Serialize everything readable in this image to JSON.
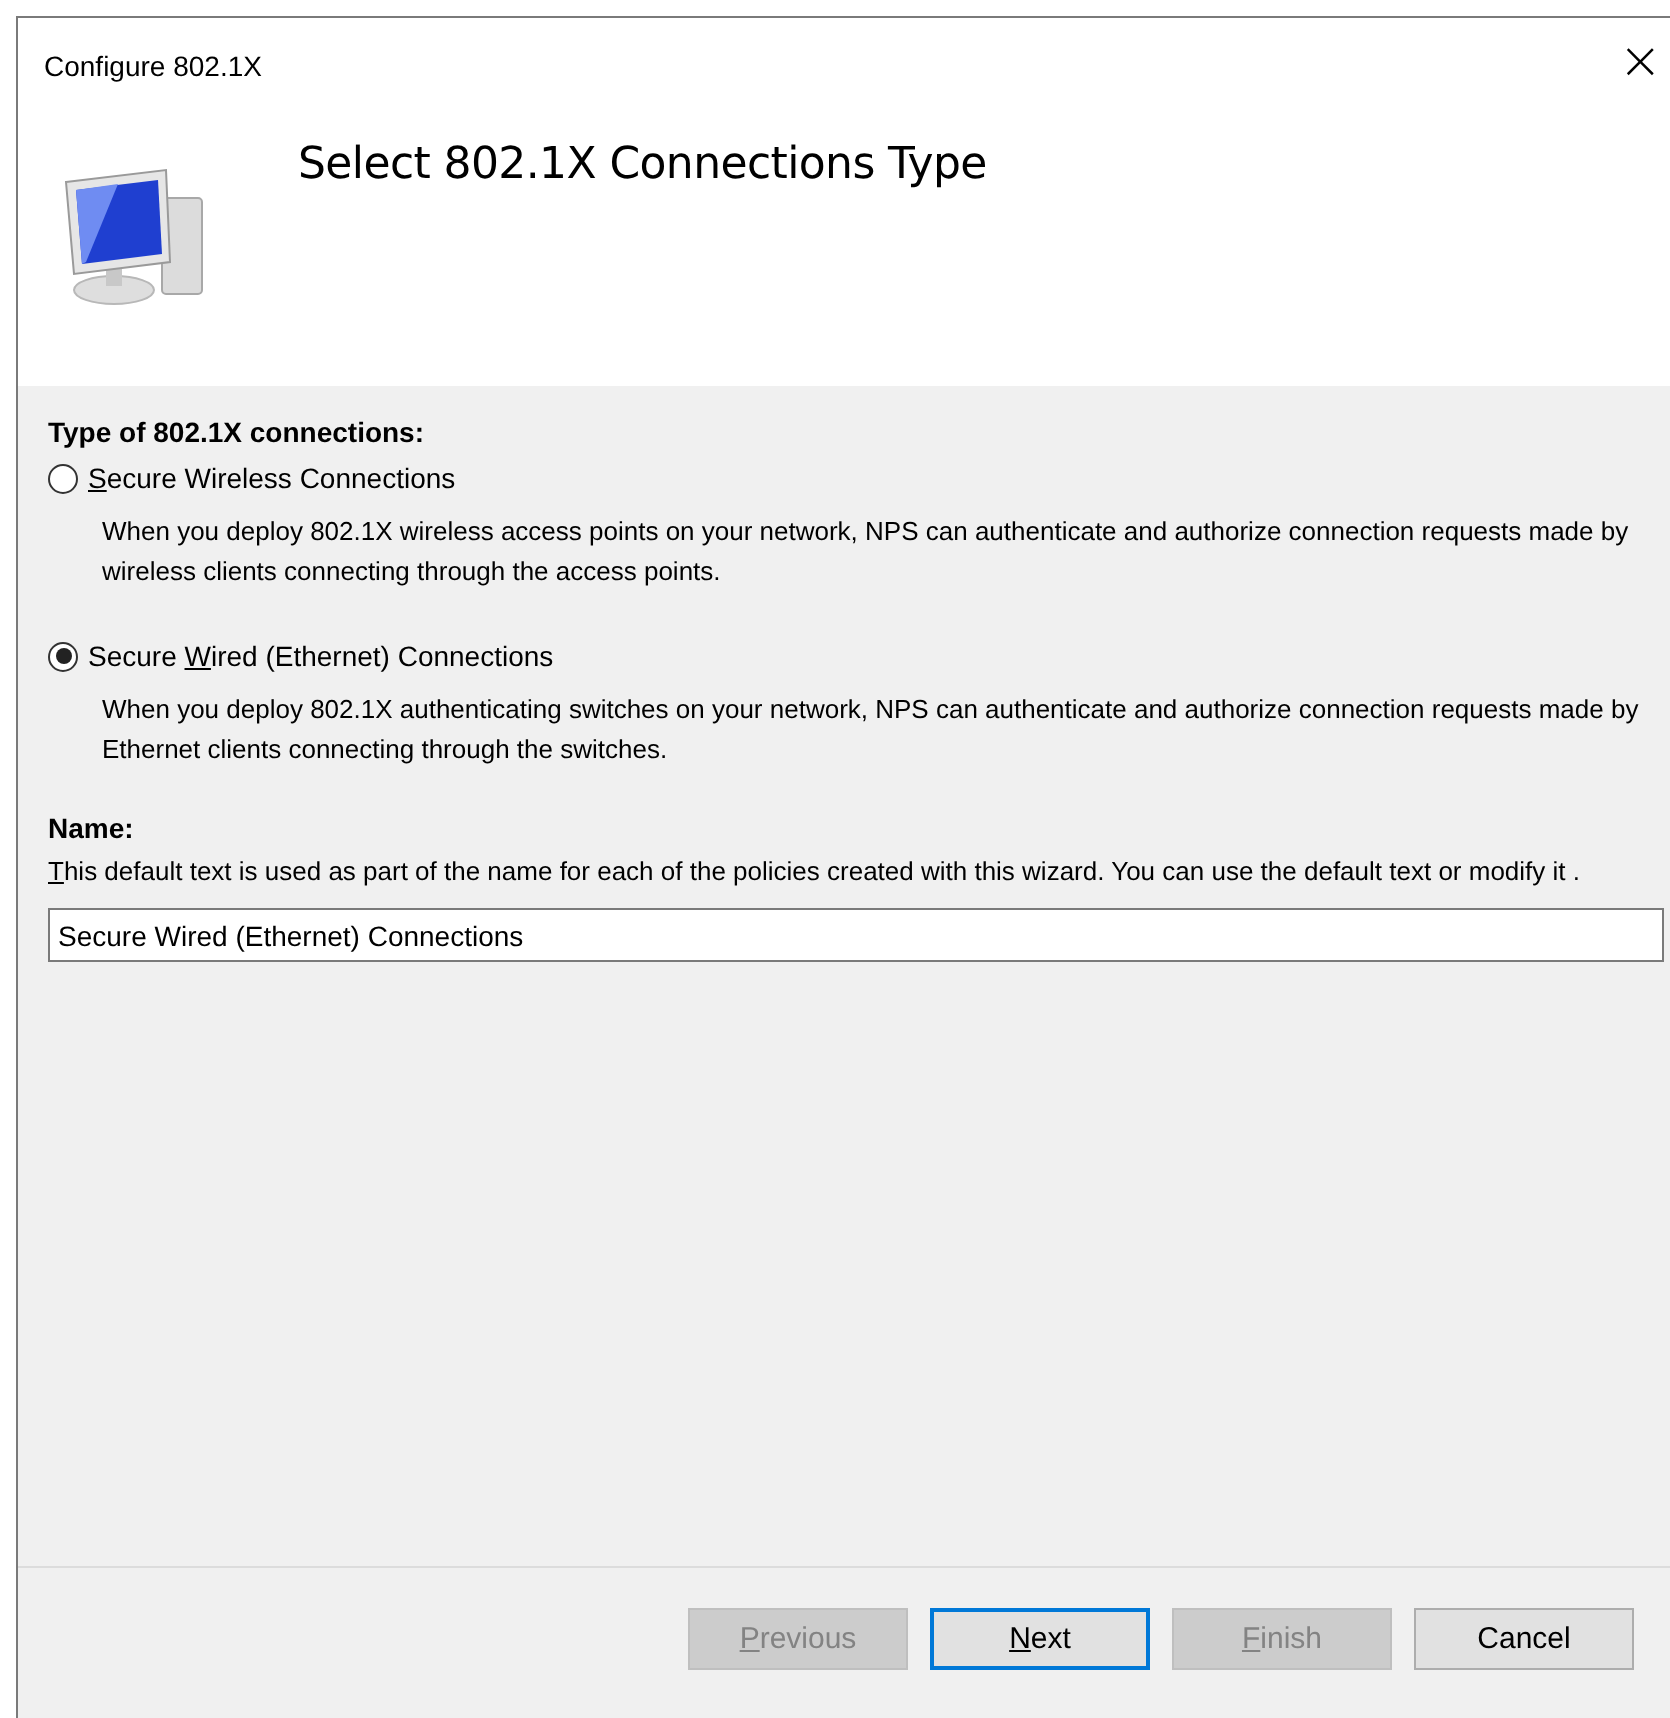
{
  "window": {
    "title": "Configure 802.1X",
    "close": "×"
  },
  "header": {
    "title": "Select 802.1X Connections Type"
  },
  "connection_type": {
    "heading": "Type of 802.1X connections:",
    "options": [
      {
        "access_key": "S",
        "text_after": "ecure Wireless Connections",
        "selected": false,
        "description": "When you deploy 802.1X wireless access points on your network, NPS can authenticate and authorize connection requests made by wireless clients connecting through the access points."
      },
      {
        "text_before": "Secure ",
        "access_key": "W",
        "text_after": "ired (Ethernet) Connections",
        "selected": true,
        "description": "When you deploy 802.1X authenticating switches on your network, NPS can authenticate and authorize connection requests made by Ethernet clients connecting through the switches."
      }
    ]
  },
  "name": {
    "heading": "Name:",
    "access_key": "T",
    "text_after": "his default text is used as part of the name for each of the policies created with this wizard. You can use the default text or modify it .",
    "value": "Secure Wired (Ethernet) Connections"
  },
  "buttons": [
    {
      "access_key": "P",
      "text_after": "revious",
      "disabled": true,
      "focused": false
    },
    {
      "access_key": "N",
      "text_after": "ext",
      "disabled": false,
      "focused": true
    },
    {
      "access_key": "F",
      "text_after": "inish",
      "disabled": true,
      "focused": false
    },
    {
      "text_after": "Cancel",
      "disabled": false,
      "focused": false
    }
  ]
}
